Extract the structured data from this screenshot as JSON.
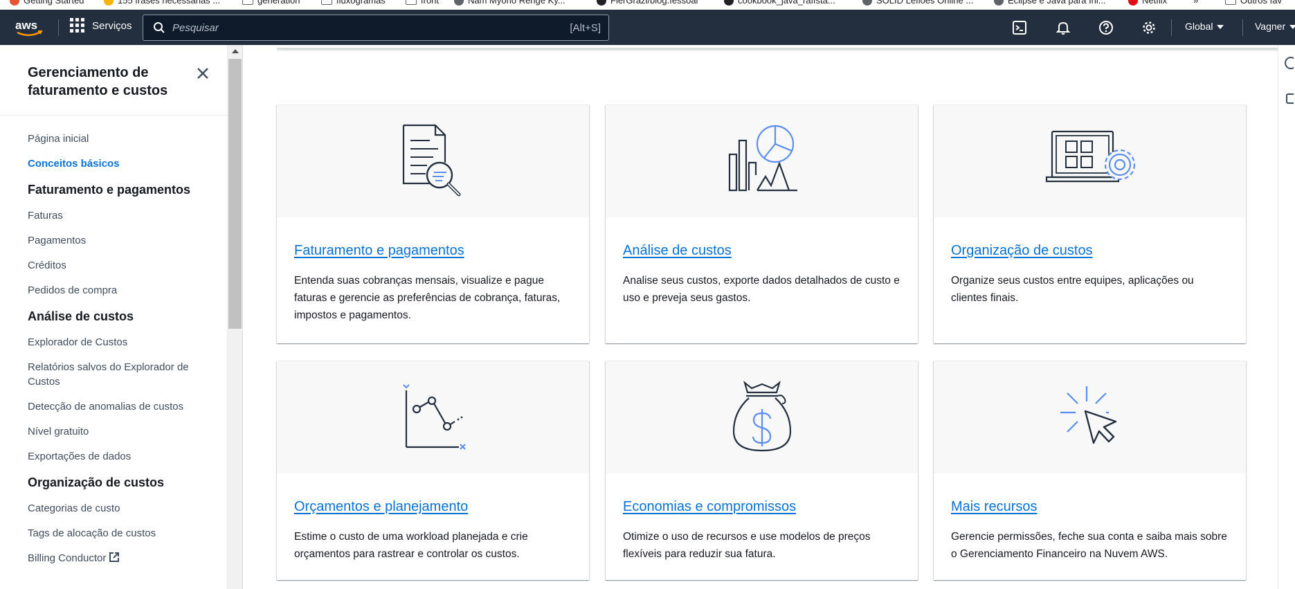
{
  "bookmarks": [
    {
      "label": "Getting Started",
      "icon": "firefox-icon",
      "color": "#e8542f"
    },
    {
      "label": "155 frases necessárias ...",
      "icon": "smiley-icon",
      "color": "#f4b400"
    },
    {
      "label": "generation",
      "icon": "folder-icon",
      "color": "#5f6368"
    },
    {
      "label": "fluxogramas",
      "icon": "folder-icon",
      "color": "#5f6368"
    },
    {
      "label": "front",
      "icon": "folder-icon",
      "color": "#5f6368"
    },
    {
      "label": "Nam Myoho Renge Ky...",
      "icon": "globe-icon",
      "color": "#5f6368"
    },
    {
      "label": "FlerGrazi/blog.fessoal",
      "icon": "github-icon",
      "color": "#202124"
    },
    {
      "label": "cookbook_java_raffsta...",
      "icon": "github-icon",
      "color": "#202124"
    },
    {
      "label": "SOLID Lefloes Online ...",
      "icon": "globe-icon",
      "color": "#5f6368"
    },
    {
      "label": "Eclipse e Java para Ini...",
      "icon": "globe-icon",
      "color": "#5f6368"
    },
    {
      "label": "Netflix",
      "icon": "netflix-icon",
      "color": "#e50914"
    },
    {
      "label": "»",
      "icon": "",
      "color": ""
    },
    {
      "label": "Outros fav",
      "icon": "folder-icon",
      "color": "#5f6368"
    }
  ],
  "topnav": {
    "brand": "aws",
    "services_label": "Serviços",
    "search_placeholder": "Pesquisar",
    "search_shortcut": "[Alt+S]",
    "region_label": "Global",
    "user_label": "Vagner"
  },
  "sidenav": {
    "header": "Gerenciamento de faturamento e custos",
    "items": [
      {
        "label": "Página inicial",
        "kind": "link"
      },
      {
        "label": "Conceitos básicos",
        "kind": "active"
      },
      {
        "label": "Faturamento e pagamentos",
        "kind": "section"
      },
      {
        "label": "Faturas",
        "kind": "link"
      },
      {
        "label": "Pagamentos",
        "kind": "link"
      },
      {
        "label": "Créditos",
        "kind": "link"
      },
      {
        "label": "Pedidos de compra",
        "kind": "link"
      },
      {
        "label": "Análise de custos",
        "kind": "section"
      },
      {
        "label": "Explorador de Custos",
        "kind": "link"
      },
      {
        "label": "Relatórios salvos do Explorador de Custos",
        "kind": "link"
      },
      {
        "label": "Detecção de anomalias de custos",
        "kind": "link"
      },
      {
        "label": "Nível gratuito",
        "kind": "link"
      },
      {
        "label": "Exportações de dados",
        "kind": "link"
      },
      {
        "label": "Organização de custos",
        "kind": "section"
      },
      {
        "label": "Categorias de custo",
        "kind": "link"
      },
      {
        "label": "Tags de alocação de custos",
        "kind": "link"
      },
      {
        "label": "Billing Conductor",
        "kind": "external"
      }
    ]
  },
  "cards": [
    {
      "title": "Faturamento e pagamentos",
      "description": "Entenda suas cobranças mensais, visualize e pague faturas e gerencie as preferências de cobrança, faturas, impostos e pagamentos.",
      "icon": "document-search-icon"
    },
    {
      "title": "Análise de custos",
      "description": "Analise seus custos, exporte dados detalhados de custo e uso e preveja seus gastos.",
      "icon": "chart-analysis-icon"
    },
    {
      "title": "Organização de custos",
      "description": "Organize seus custos entre equipes, aplicações ou clientes finais.",
      "icon": "laptop-gear-icon"
    },
    {
      "title": "Orçamentos e planejamento",
      "description": "Estime o custo de uma workload planejada e crie orçamentos para rastrear e controlar os custos.",
      "icon": "line-chart-icon"
    },
    {
      "title": "Economias e compromissos",
      "description": "Otimize o uso de recursos e use modelos de preços flexíveis para reduzir sua fatura.",
      "icon": "money-bag-icon"
    },
    {
      "title": "Mais recursos",
      "description": "Gerencie permissões, feche sua conta e saiba mais sobre o Gerenciamento Financeiro na Nuvem AWS.",
      "icon": "cursor-click-icon"
    }
  ],
  "colors": {
    "nav_bg": "#232f3e",
    "link_blue": "#0972d3",
    "illustration_blue": "#5b8def",
    "text_dark": "#16191f"
  }
}
